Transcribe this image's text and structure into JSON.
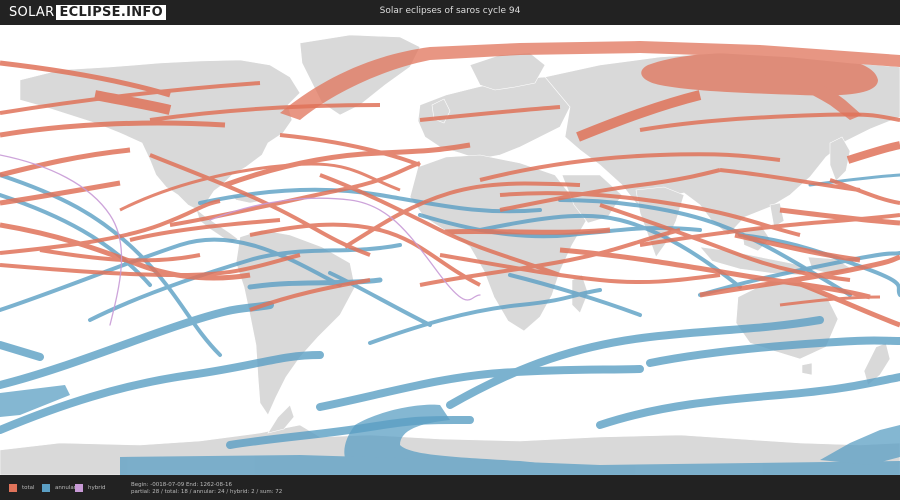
{
  "header": {
    "logo_left": "SOLAR",
    "logo_right": "ECLIPSE.INFO",
    "title": "Solar eclipses of saros cycle 94"
  },
  "legend": [
    {
      "key": "total",
      "label": "total",
      "color": "#e0735a"
    },
    {
      "key": "annular",
      "label": "annular",
      "color": "#5b9fc4"
    },
    {
      "key": "hybrid",
      "label": "hybrid",
      "color": "#c89ad6"
    }
  ],
  "footer": {
    "range": "Begin: -0018-07-09 End: 1262-08-16",
    "counts": "partial: 28 / total: 18 / annular: 24 / hybrid: 2 / sum: 72"
  },
  "map": {
    "projection": "equirectangular",
    "land_color": "#d9d9d9",
    "ocean_color": "#ffffff",
    "total_color": "#e0735a",
    "annular_color": "#5b9fc4",
    "hybrid_color": "#c89ad6"
  }
}
